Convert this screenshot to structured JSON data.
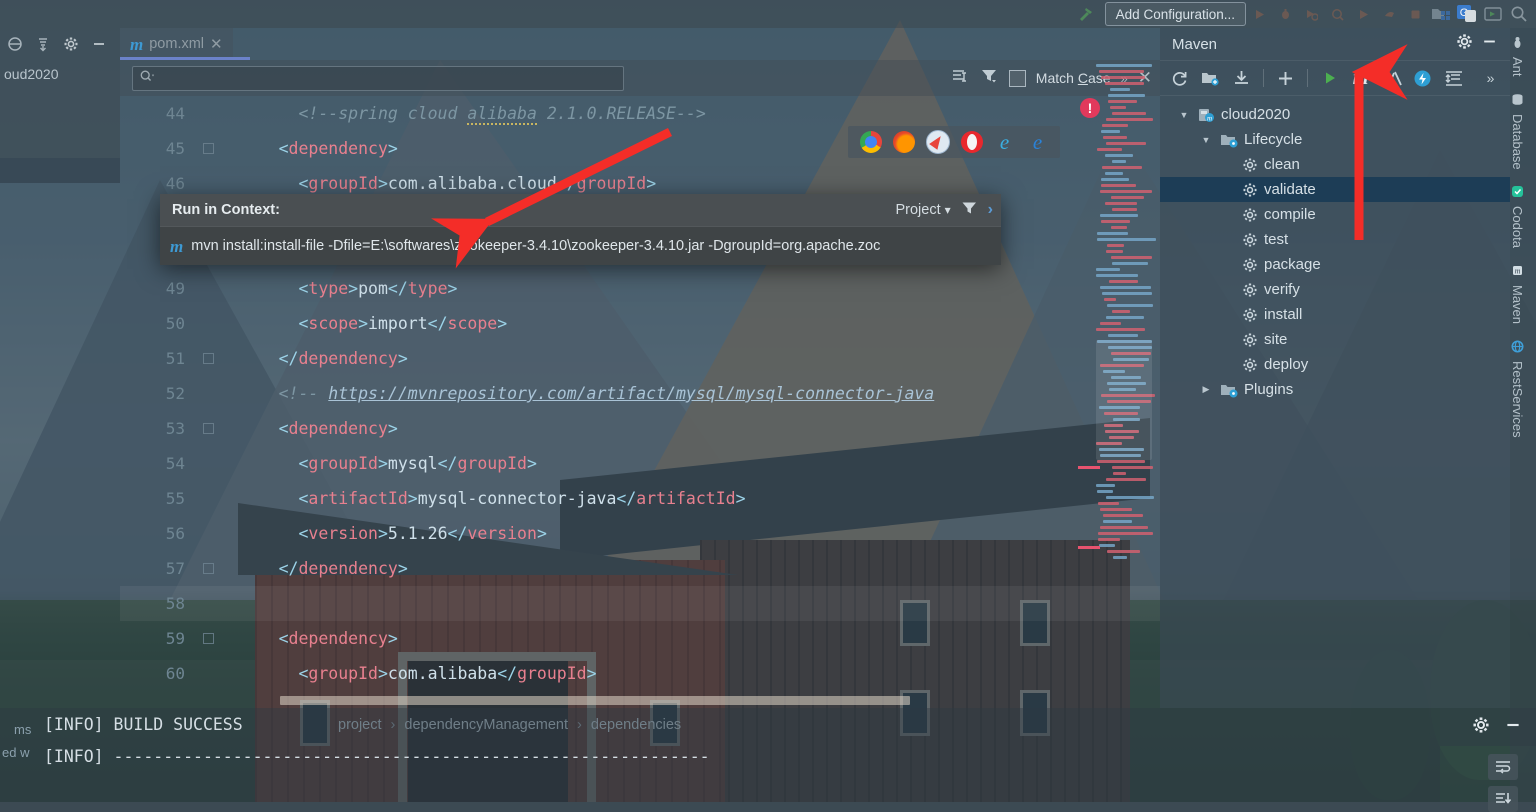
{
  "topbar": {
    "add_configuration_label": "Add Configuration...",
    "hammer_icon": "build-hammer-icon",
    "icons": [
      "run-icon",
      "debug-icon",
      "run-with-coverage-icon",
      "profile-icon",
      "run-anything-icon",
      "attach-icon",
      "stop-icon",
      "project-structure-icon",
      "search-everywhere-icon",
      "run-dashboard-icon",
      "magnifier-icon"
    ]
  },
  "left_panel": {
    "title": "oud2020",
    "icons": [
      "collapse-all-icon",
      "expand-select-icon",
      "gear-icon",
      "minimize-icon"
    ]
  },
  "editor": {
    "tab": {
      "label": "pom.xml",
      "badge": "m",
      "close": "✕"
    },
    "find": {
      "placeholder": "",
      "value": "",
      "match_case_label": "Match Case",
      "match_case_mnemonic": "C",
      "icons": [
        "filter-lines-icon",
        "filter-icon",
        "more-chevrons-icon",
        "close-icon"
      ]
    },
    "breadcrumb": [
      "project",
      "dependencyManagement",
      "dependencies"
    ],
    "breadcrumb_separator": "›",
    "lines": [
      {
        "num": "44",
        "fold": false,
        "indent": 0,
        "type": "comment",
        "text": "<!--spring cloud alibaba 2.1.0.RELEASE-->"
      },
      {
        "num": "45",
        "fold": true,
        "indent": 0,
        "type": "tag-open",
        "text": "<dependency>"
      },
      {
        "num": "46",
        "fold": false,
        "indent": 1,
        "type": "element",
        "tag": "groupId",
        "value": "com.alibaba.cloud"
      },
      {
        "num": "47",
        "fold": false,
        "indent": 1,
        "type": "hidden",
        "text": ""
      },
      {
        "num": "48",
        "fold": false,
        "indent": 1,
        "type": "hidden",
        "text": ""
      },
      {
        "num": "49",
        "fold": false,
        "indent": 1,
        "type": "element",
        "tag": "type",
        "value": "pom"
      },
      {
        "num": "50",
        "fold": false,
        "indent": 1,
        "type": "element",
        "tag": "scope",
        "value": "import"
      },
      {
        "num": "51",
        "fold": true,
        "indent": 0,
        "type": "tag-close",
        "text": "</dependency>"
      },
      {
        "num": "52",
        "fold": false,
        "indent": 0,
        "type": "comment-link",
        "prefix": "<!-- ",
        "link": "https://mvnrepository.com/artifact/mysql/mysql-connector-java"
      },
      {
        "num": "53",
        "fold": true,
        "indent": 0,
        "type": "tag-open",
        "text": "<dependency>"
      },
      {
        "num": "54",
        "fold": false,
        "indent": 1,
        "type": "element",
        "tag": "groupId",
        "value": "mysql"
      },
      {
        "num": "55",
        "fold": false,
        "indent": 1,
        "type": "element",
        "tag": "artifactId",
        "value": "mysql-connector-java"
      },
      {
        "num": "56",
        "fold": false,
        "indent": 1,
        "type": "element",
        "tag": "version",
        "value": "5.1.26"
      },
      {
        "num": "57",
        "fold": true,
        "indent": 0,
        "type": "tag-close",
        "text": "</dependency>"
      },
      {
        "num": "58",
        "fold": false,
        "indent": 0,
        "type": "blank",
        "text": ""
      },
      {
        "num": "59",
        "fold": true,
        "indent": 0,
        "type": "tag-open",
        "text": "<dependency>"
      },
      {
        "num": "60",
        "fold": false,
        "indent": 1,
        "type": "element",
        "tag": "groupId",
        "value": "com.alibaba"
      }
    ]
  },
  "browsers": [
    "chrome-icon",
    "firefox-icon",
    "safari-icon",
    "opera-icon",
    "internet-explorer-icon",
    "edge-icon"
  ],
  "run_popup": {
    "title": "Run in Context:",
    "scope_label": "Project",
    "scope_chevron": "⌄",
    "filter_icon": "filter-icon",
    "expand_icon": "chevron-right-icon",
    "item_badge": "m",
    "command": "mvn install:install-file -Dfile=E:\\softwares\\zookeeper-3.4.10\\zookeeper-3.4.10.jar -DgroupId=org.apache.zoc"
  },
  "maven": {
    "title": "Maven",
    "header_icons": [
      "gear-icon",
      "minimize-icon"
    ],
    "toolbar_icons": [
      "reimport-icon",
      "generate-sources-icon",
      "download-sources-icon",
      "add-maven-project-icon",
      "run-icon",
      "execute-maven-goal-icon",
      "toggle-skip-tests-icon",
      "offline-mode-icon",
      "expand-all-icon",
      "more-chevrons-icon"
    ],
    "tree": [
      {
        "label": "cloud2020",
        "depth": 0,
        "arrow": "▼",
        "icon": "maven-project-icon",
        "selected": false
      },
      {
        "label": "Lifecycle",
        "depth": 1,
        "arrow": "▼",
        "icon": "lifecycle-folder-icon",
        "selected": false
      },
      {
        "label": "clean",
        "depth": 2,
        "arrow": "",
        "icon": "goal-gear-icon",
        "selected": false
      },
      {
        "label": "validate",
        "depth": 2,
        "arrow": "",
        "icon": "goal-gear-icon",
        "selected": true
      },
      {
        "label": "compile",
        "depth": 2,
        "arrow": "",
        "icon": "goal-gear-icon",
        "selected": false
      },
      {
        "label": "test",
        "depth": 2,
        "arrow": "",
        "icon": "goal-gear-icon",
        "selected": false
      },
      {
        "label": "package",
        "depth": 2,
        "arrow": "",
        "icon": "goal-gear-icon",
        "selected": false
      },
      {
        "label": "verify",
        "depth": 2,
        "arrow": "",
        "icon": "goal-gear-icon",
        "selected": false
      },
      {
        "label": "install",
        "depth": 2,
        "arrow": "",
        "icon": "goal-gear-icon",
        "selected": false
      },
      {
        "label": "site",
        "depth": 2,
        "arrow": "",
        "icon": "goal-gear-icon",
        "selected": false
      },
      {
        "label": "deploy",
        "depth": 2,
        "arrow": "",
        "icon": "goal-gear-icon",
        "selected": false
      },
      {
        "label": "Plugins",
        "depth": 1,
        "arrow": "▶",
        "icon": "plugins-folder-icon",
        "selected": false
      }
    ]
  },
  "right_strip": [
    {
      "label": "Ant",
      "icon": "ant-icon"
    },
    {
      "label": "Database",
      "icon": "database-icon"
    },
    {
      "label": "Codota",
      "icon": "codota-icon"
    },
    {
      "label": "Maven",
      "icon": "maven-icon"
    },
    {
      "label": "RestServices",
      "icon": "rest-services-icon"
    }
  ],
  "console": {
    "lines": [
      "[INFO] BUILD SUCCESS",
      "[INFO] ------------------------------------------------------------"
    ],
    "left_fragments": [
      "ms",
      "ed w"
    ],
    "icons": [
      "gear-icon",
      "minimize-icon",
      "soft-wrap-icon",
      "scroll-to-end-icon"
    ]
  },
  "colors": {
    "accent_blue": "#6b82c9",
    "selection_blue": "#1a3c56",
    "annotation_red": "#f42d28",
    "maven_m_blue": "#3d9ad4",
    "tag_pink": "#e8808f",
    "bracket_blue": "#9cd3e8",
    "text_light": "#cfe0ea",
    "comment_gray": "#7d96a3",
    "error_red": "#e2395c",
    "run_green": "#4caf50"
  }
}
